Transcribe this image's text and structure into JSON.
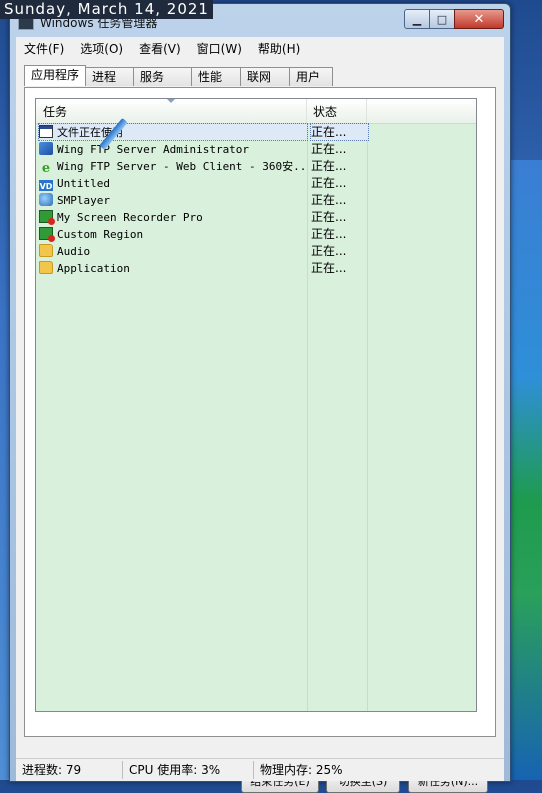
{
  "overlay": {
    "date": "Sunday, March 14, 2021"
  },
  "window": {
    "title": "Windows 任务管理器",
    "min_icon": "minimize-icon",
    "max_icon": "maximize-icon",
    "close_icon": "close-icon"
  },
  "menu": [
    "文件(F)",
    "选项(O)",
    "查看(V)",
    "窗口(W)",
    "帮助(H)"
  ],
  "tabs": [
    "应用程序",
    "进程",
    "服务",
    "性能",
    "联网",
    "用户"
  ],
  "listview": {
    "columns": {
      "task": "任务",
      "status": "状态"
    },
    "rows": [
      {
        "icon": "window-icon",
        "task": "文件正在使用",
        "status": "正在..."
      },
      {
        "icon": "wing-ftp-icon",
        "task": "Wing FTP Server Administrator",
        "status": "正在..."
      },
      {
        "icon": "ie-icon",
        "task": "Wing FTP Server - Web Client - 360安...",
        "status": "正在..."
      },
      {
        "icon": "vd-icon",
        "task": "Untitled",
        "status": "正在..."
      },
      {
        "icon": "smplayer-icon",
        "task": "SMPlayer",
        "status": "正在..."
      },
      {
        "icon": "recorder-icon",
        "task": "My Screen Recorder Pro",
        "status": "正在..."
      },
      {
        "icon": "recorder-icon",
        "task": "Custom Region",
        "status": "正在..."
      },
      {
        "icon": "folder-icon",
        "task": "Audio",
        "status": "正在..."
      },
      {
        "icon": "folder-icon",
        "task": "Application",
        "status": "正在..."
      }
    ]
  },
  "buttons": {
    "end_task": "结束任务(E)",
    "switch_to": "切换至(S)",
    "new_task": "新任务(N)..."
  },
  "statusbar": {
    "processes": "进程数: 79",
    "cpu": "CPU 使用率: 3%",
    "memory": "物理内存: 25%"
  }
}
